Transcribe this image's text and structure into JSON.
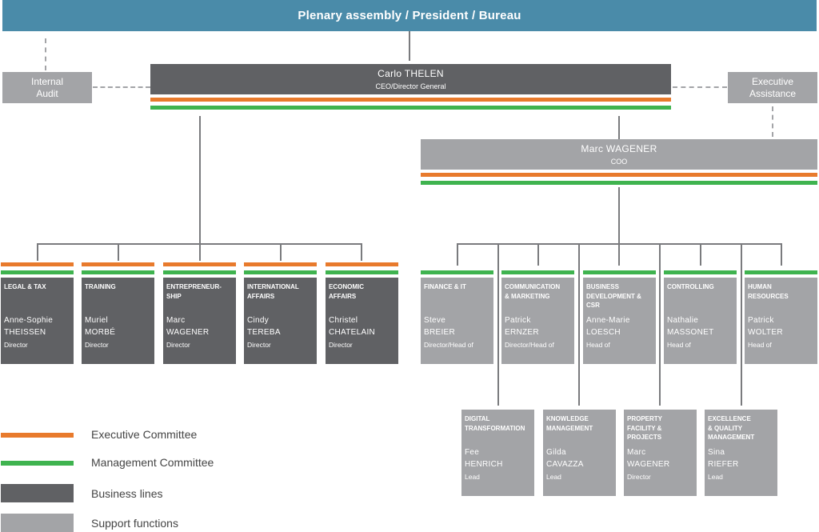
{
  "header": {
    "title": "Plenary assembly / President / Bureau"
  },
  "internal_audit": {
    "line1": "Internal",
    "line2": "Audit"
  },
  "executive_assistance": {
    "line1": "Executive",
    "line2": "Assistance"
  },
  "ceo": {
    "name": "Carlo THELEN",
    "role": "CEO/Director General"
  },
  "coo": {
    "name": "Marc WAGENER",
    "role": "COO"
  },
  "business_lines": [
    {
      "title": "LEGAL & TAX",
      "first": "Anne-Sophie",
      "last": "THEISSEN",
      "position": "Director"
    },
    {
      "title": "TRAINING",
      "first": "Muriel",
      "last": "MORBÉ",
      "position": "Director"
    },
    {
      "title": "ENTREPRENEUR-\nSHIP",
      "first": "Marc",
      "last": "WAGENER",
      "position": "Director"
    },
    {
      "title": "INTERNATIONAL\nAFFAIRS",
      "first": "Cindy",
      "last": "TEREBA",
      "position": "Director"
    },
    {
      "title": "ECONOMIC\nAFFAIRS",
      "first": "Christel",
      "last": "CHATELAIN",
      "position": "Director"
    }
  ],
  "support_functions": [
    {
      "title": "FINANCE & IT",
      "first": "Steve",
      "last": "BREIER",
      "position": "Director/Head of"
    },
    {
      "title": "COMMUNICATION\n& MARKETING",
      "first": "Patrick",
      "last": "ERNZER",
      "position": "Director/Head of"
    },
    {
      "title": "BUSINESS\nDEVELOPMENT &\nCSR",
      "first": "Anne-Marie",
      "last": "LOESCH",
      "position": "Head of"
    },
    {
      "title": "CONTROLLING",
      "first": "Nathalie",
      "last": "MASSONET",
      "position": "Head of"
    },
    {
      "title": "HUMAN\nRESOURCES",
      "first": "Patrick",
      "last": "WOLTER",
      "position": "Head of"
    }
  ],
  "sub_units": [
    {
      "title": "DIGITAL\nTRANSFORMATION",
      "first": "Fee",
      "last": "HENRICH",
      "position": "Lead"
    },
    {
      "title": "KNOWLEDGE\nMANAGEMENT",
      "first": "Gilda",
      "last": "CAVAZZA",
      "position": "Lead"
    },
    {
      "title": "PROPERTY\nFACILITY &\nPROJECTS",
      "first": "Marc",
      "last": "WAGENER",
      "position": "Director"
    },
    {
      "title": "EXCELLENCE\n& QUALITY\nMANAGEMENT",
      "first": "Sina",
      "last": "RIEFER",
      "position": "Lead"
    }
  ],
  "legend": {
    "executive_committee": "Executive Committee",
    "management_committee": "Management Committee",
    "business_lines": "Business lines",
    "support_functions": "Support functions"
  },
  "colors": {
    "header": "#4a8ba9",
    "executive_committee": "#e87a2c",
    "management_committee": "#3fb34f",
    "business_lines": "#606164",
    "support_functions": "#a3a4a7"
  }
}
